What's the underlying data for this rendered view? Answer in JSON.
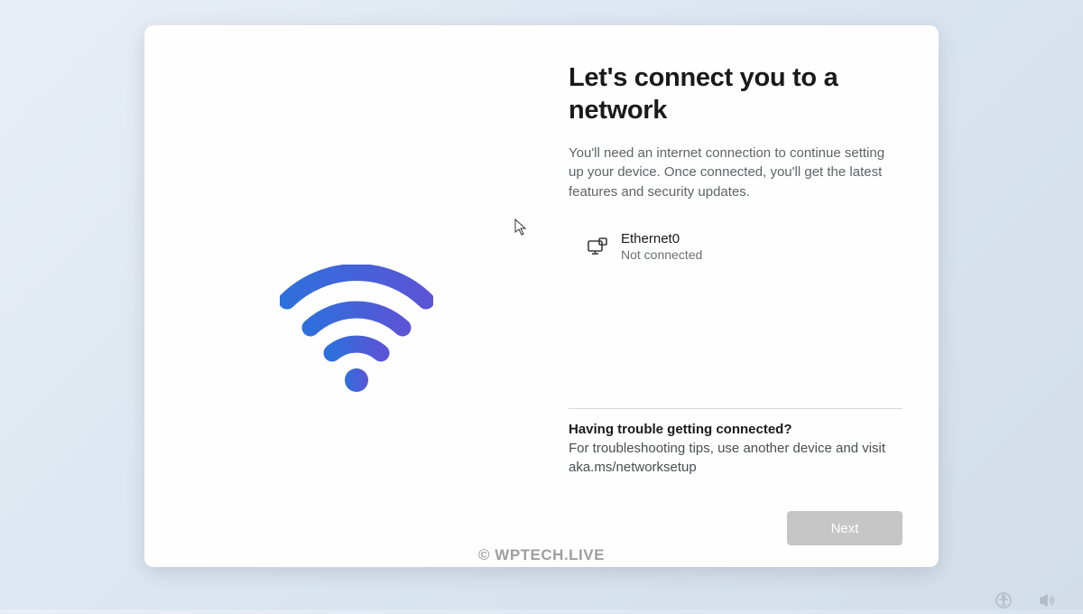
{
  "title": "Let's connect you to a network",
  "subtitle": "You'll need an internet connection to continue setting up your device. Once connected, you'll get the latest features and security updates.",
  "network": {
    "name": "Ethernet0",
    "status": "Not connected"
  },
  "help": {
    "title": "Having trouble getting connected?",
    "text": "For troubleshooting tips, use another device and visit aka.ms/networksetup"
  },
  "buttons": {
    "next": "Next"
  },
  "watermark": "© WPTECH.LIVE"
}
